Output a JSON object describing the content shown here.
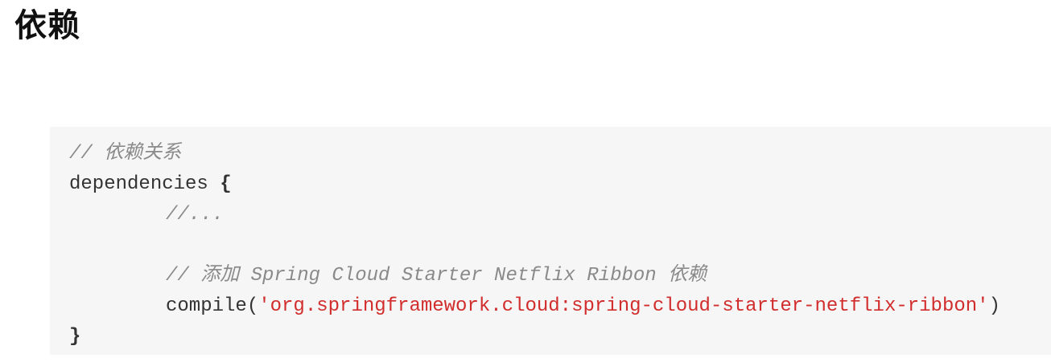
{
  "heading": "依赖",
  "code": {
    "comment_dependencies": "// 依赖关系",
    "dependencies_keyword": "dependencies",
    "open_brace": "{",
    "ellipsis_comment": "//...",
    "comment_add": "// 添加 Spring Cloud Starter Netflix Ribbon 依赖",
    "compile_fn": "compile(",
    "compile_arg": "'org.springframework.cloud:spring-cloud-starter-netflix-ribbon'",
    "close_paren": ")",
    "close_brace": "}"
  },
  "colors": {
    "comment": "#8a8a8a",
    "string": "#d22d2d",
    "code_background": "#f6f6f6",
    "text": "#333333"
  }
}
